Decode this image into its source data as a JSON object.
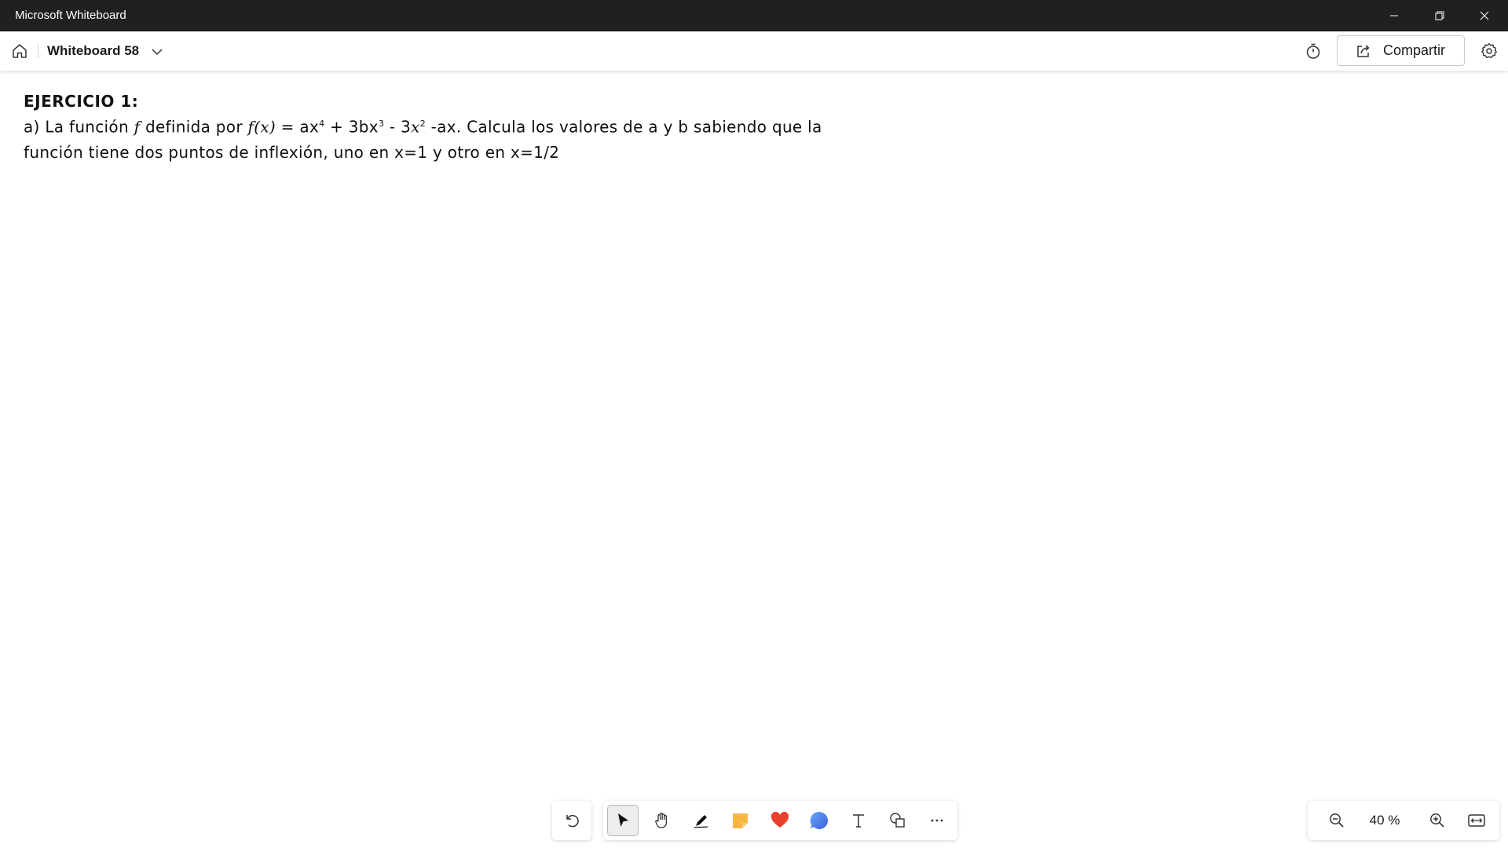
{
  "window": {
    "app_title": "Microsoft Whiteboard"
  },
  "header": {
    "board_title": "Whiteboard 58",
    "share_label": "Compartir"
  },
  "canvas": {
    "heading": "EJERCICIO 1:",
    "line1": {
      "part1": "a) La función ",
      "f": "f",
      "part2": " definida por ",
      "fx": "f(x)",
      "part3": " = ax",
      "exp1": "4",
      "part4": " + 3bx",
      "exp2": "3",
      "part5": " - 3",
      "x": "x",
      "exp3": "2",
      "part6": " -ax. Calcula los valores de a y b sabiendo que la"
    },
    "line2": "función tiene dos puntos de inflexión, uno en x=1 y otro en x=1/2"
  },
  "toolbar": {
    "tools": [
      "undo-icon",
      "select-pointer-icon",
      "hand-pan-icon",
      "pen-icon",
      "sticky-note-icon",
      "reaction-heart-icon",
      "comment-bubble-icon",
      "text-icon",
      "shapes-icon",
      "more-icon"
    ],
    "active_tool": "select-pointer-icon"
  },
  "zoom": {
    "level": "40 %"
  },
  "colors": {
    "titlebar": "#202020",
    "sticky": "#f7b742",
    "heart": "#e8412c",
    "bubble": "#4a7fe0"
  }
}
